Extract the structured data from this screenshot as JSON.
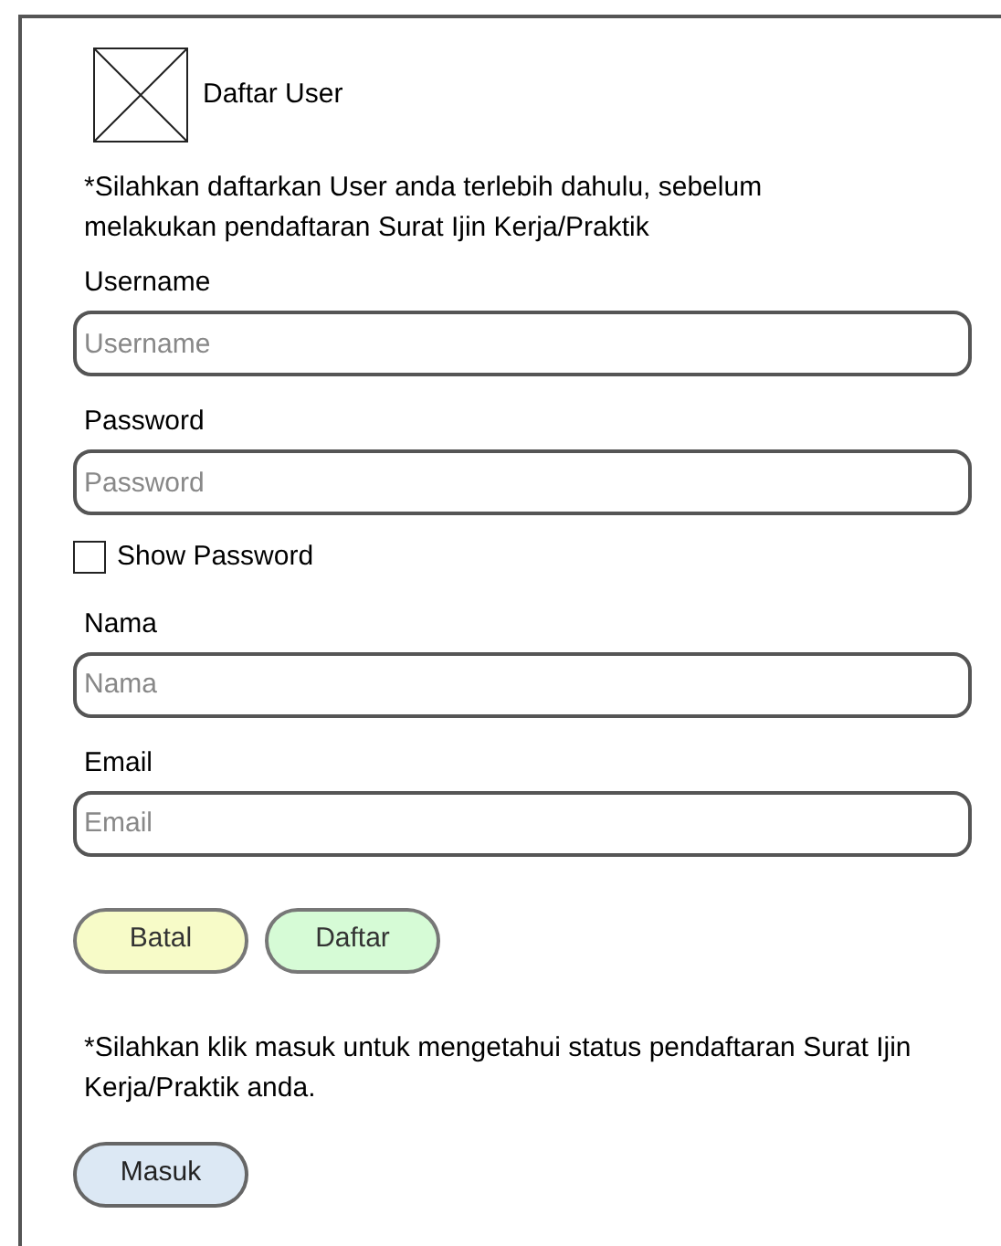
{
  "header": {
    "title": "Daftar User"
  },
  "intro": "*Silahkan daftarkan User anda terlebih dahulu, sebelum melakukan pendaftaran Surat Ijin Kerja/Praktik",
  "form": [
    {
      "kind": "field",
      "label": "Username",
      "placeholder": "Username"
    },
    {
      "kind": "field",
      "label": "Password",
      "placeholder": "Password"
    },
    {
      "kind": "checkbox",
      "label": "Show Password",
      "checked": false
    },
    {
      "kind": "field",
      "label": "Nama",
      "placeholder": "Nama"
    },
    {
      "kind": "field",
      "label": "Email",
      "placeholder": "Email"
    }
  ],
  "buttons": [
    {
      "label": "Batal",
      "color": "#f7fbc8"
    },
    {
      "label": "Daftar",
      "color": "#d6fbd6"
    }
  ],
  "note": "*Silahkan klik masuk untuk mengetahui status pendaftaran Surat Ijin Kerja/Praktik anda.",
  "login_button": {
    "label": "Masuk",
    "color": "#dce8f4"
  }
}
